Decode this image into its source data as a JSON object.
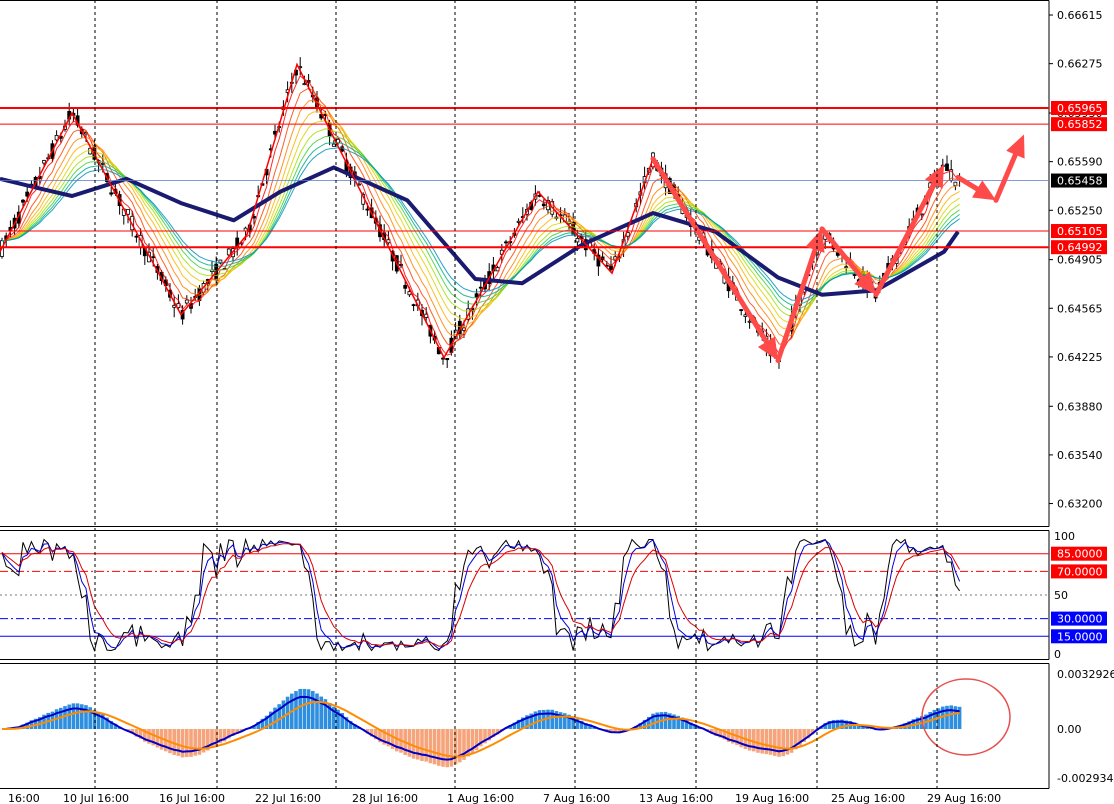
{
  "chart_data": {
    "type": "candlestick",
    "instrument_panel": {
      "y_ticks": [
        "0.66615",
        "0.66275",
        "0.65930",
        "0.65590",
        "0.65250",
        "0.64905",
        "0.64565",
        "0.64225",
        "0.63880",
        "0.63540",
        "0.63200"
      ],
      "ylim": [
        0.6305,
        0.6672
      ],
      "current_price": {
        "label": "0.65458",
        "value": 0.65458
      },
      "horizontal_levels": [
        {
          "label": "0.65965",
          "value": 0.65965
        },
        {
          "label": "0.65852",
          "value": 0.65852
        },
        {
          "label": "0.65105",
          "value": 0.65105
        },
        {
          "label": "0.64992",
          "value": 0.64992
        }
      ],
      "zigzag_pivots": [
        {
          "x": "2 Jul 16:00",
          "y": 0.6496
        },
        {
          "x": "9 Jul 16:00",
          "y": 0.6593
        },
        {
          "x": "15 Jul 16:00",
          "y": 0.6452
        },
        {
          "x": "20 Jul 16:00",
          "y": 0.6508
        },
        {
          "x": "23 Jul 16:00",
          "y": 0.6627
        },
        {
          "x": "31 Jul 16:00",
          "y": 0.6422
        },
        {
          "x": "6 Aug 16:00",
          "y": 0.6538
        },
        {
          "x": "11 Aug 16:00",
          "y": 0.6481
        },
        {
          "x": "13 Aug 16:00",
          "y": 0.6561
        }
      ],
      "arrows": [
        {
          "from": {
            "x": "13 Aug 16:00",
            "y": 0.6561
          },
          "to": {
            "x": "19 Aug 16:00",
            "y": 0.642
          }
        },
        {
          "from": {
            "x": "19 Aug 16:00",
            "y": 0.642
          },
          "to": {
            "x": "22 Aug 16:00",
            "y": 0.6512
          }
        },
        {
          "from": {
            "x": "22 Aug 16:00",
            "y": 0.6512
          },
          "to": {
            "x": "26 Aug 16:00",
            "y": 0.6466
          }
        },
        {
          "from": {
            "x": "26 Aug 16:00",
            "y": 0.6466
          },
          "to": {
            "x": "29 Aug 16:00",
            "y": 0.6557
          }
        },
        {
          "from": {
            "x": "30 Aug 16:00",
            "y": 0.6548
          },
          "to": {
            "x": "31 Aug 16:00",
            "y": 0.6532
          }
        },
        {
          "from": {
            "x": "31 Aug 16:00",
            "y": 0.6532
          },
          "to": {
            "x": "1 Sep 16:00",
            "y": 0.6578
          }
        }
      ],
      "slow_ma": [
        {
          "x": "2 Jul 16:00",
          "y": 0.6547
        },
        {
          "x": "6 Jul 16:00",
          "y": 0.654
        },
        {
          "x": "9 Jul 16:00",
          "y": 0.6535
        },
        {
          "x": "12 Jul 16:00",
          "y": 0.6547
        },
        {
          "x": "15 Jul 16:00",
          "y": 0.653
        },
        {
          "x": "19 Jul 16:00",
          "y": 0.6518
        },
        {
          "x": "22 Jul 16:00",
          "y": 0.6538
        },
        {
          "x": "25 Jul 16:00",
          "y": 0.6555
        },
        {
          "x": "29 Jul 16:00",
          "y": 0.6532
        },
        {
          "x": "2 Aug 16:00",
          "y": 0.6477
        },
        {
          "x": "5 Aug 16:00",
          "y": 0.6474
        },
        {
          "x": "9 Aug 16:00",
          "y": 0.6501
        },
        {
          "x": "13 Aug 16:00",
          "y": 0.6523
        },
        {
          "x": "16 Aug 16:00",
          "y": 0.651
        },
        {
          "x": "19 Aug 16:00",
          "y": 0.6478
        },
        {
          "x": "22 Aug 16:00",
          "y": 0.6466
        },
        {
          "x": "26 Aug 16:00",
          "y": 0.6469
        },
        {
          "x": "29 Aug 16:00",
          "y": 0.6496
        },
        {
          "x": "30 Aug 16:00",
          "y": 0.651
        }
      ]
    },
    "stochastic_panel": {
      "y_ticks": [
        100,
        50,
        0
      ],
      "ylim": [
        0,
        100
      ],
      "levels": [
        {
          "label": "85.0000",
          "value": 85,
          "color": "#ff0000"
        },
        {
          "label": "70.0000",
          "value": 70,
          "color": "#ff0000"
        },
        {
          "label": "30.0000",
          "value": 30,
          "color": "#0000ff"
        },
        {
          "label": "15.0000",
          "value": 15,
          "color": "#0000ff"
        }
      ]
    },
    "macd_panel": {
      "y_ticks": [
        "0.0032926",
        "0.00",
        "-0.0029346"
      ],
      "ylim": [
        -0.0029346,
        0.0032926
      ]
    },
    "x_ticks": [
      "16:00",
      "10 Jul 16:00",
      "16 Jul 16:00",
      "22 Jul 16:00",
      "28 Jul 16:00",
      "1 Aug 16:00",
      "7 Aug 16:00",
      "13 Aug 16:00",
      "19 Aug 16:00",
      "25 Aug 16:00",
      "29 Aug 16:00"
    ],
    "colors": {
      "bull": "#000000",
      "bear": "#000000",
      "level": "#ff0000",
      "current": "#000000",
      "slow_ma": "#1a1a70",
      "zigzag": "#ff0000",
      "arrow": "#ff4a4a",
      "macd_pos": "#2f8fdf",
      "macd_neg": "#f6a47c",
      "macd_line": "#0000c8",
      "signal_line": "#ff8c00"
    }
  }
}
